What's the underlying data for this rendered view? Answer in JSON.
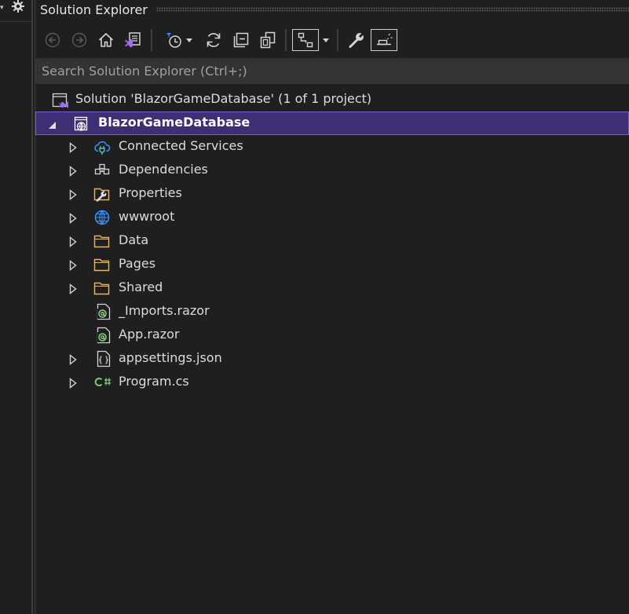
{
  "panel": {
    "title": "Solution Explorer"
  },
  "search": {
    "placeholder": "Search Solution Explorer (Ctrl+;)"
  },
  "toolbar": {
    "buttons": [
      {
        "icon": "back-arrow-icon",
        "enabled": false
      },
      {
        "icon": "forward-arrow-icon",
        "enabled": false
      },
      {
        "icon": "home-icon",
        "enabled": true
      },
      {
        "icon": "switch-views-icon",
        "enabled": true
      },
      {
        "icon": "pending-changes-filter-icon",
        "enabled": true,
        "dropdown": true
      },
      {
        "icon": "sync-refresh-icon",
        "enabled": true
      },
      {
        "icon": "collapse-all-icon",
        "enabled": true
      },
      {
        "icon": "show-all-files-icon",
        "enabled": true
      },
      {
        "icon": "view-class-diagram-icon",
        "enabled": true,
        "dropdown": true,
        "toggled": true
      },
      {
        "icon": "properties-wrench-icon",
        "enabled": true
      },
      {
        "icon": "preview-selected-items-icon",
        "enabled": true,
        "toggled": true
      }
    ]
  },
  "tree": {
    "solution_label": "Solution 'BlazorGameDatabase' (1 of 1 project)",
    "project": {
      "label": "BlazorGameDatabase",
      "expanded": true,
      "selected": true
    },
    "items": [
      {
        "label": "Connected Services",
        "icon": "connected-services-icon",
        "expandable": true
      },
      {
        "label": "Dependencies",
        "icon": "dependencies-icon",
        "expandable": true
      },
      {
        "label": "Properties",
        "icon": "properties-folder-icon",
        "expandable": true
      },
      {
        "label": "wwwroot",
        "icon": "globe-icon",
        "expandable": true
      },
      {
        "label": "Data",
        "icon": "folder-icon",
        "expandable": true
      },
      {
        "label": "Pages",
        "icon": "folder-icon",
        "expandable": true
      },
      {
        "label": "Shared",
        "icon": "folder-icon",
        "expandable": true
      },
      {
        "label": "_Imports.razor",
        "icon": "razor-file-icon",
        "expandable": false
      },
      {
        "label": "App.razor",
        "icon": "razor-file-icon",
        "expandable": false
      },
      {
        "label": "appsettings.json",
        "icon": "json-file-icon",
        "expandable": true
      },
      {
        "label": "Program.cs",
        "icon": "csharp-file-icon",
        "expandable": true
      }
    ]
  },
  "colors": {
    "background": "#1f1f1f",
    "search_background": "#333333",
    "selection_background": "#3f2e73",
    "selection_border": "#7a5fd0",
    "folder": "#dcb67a",
    "accent_blue": "#3794ff",
    "razor_green": "#89d185",
    "csharp_green": "#7fd07a",
    "vs_purple": "#9b6fe6"
  }
}
